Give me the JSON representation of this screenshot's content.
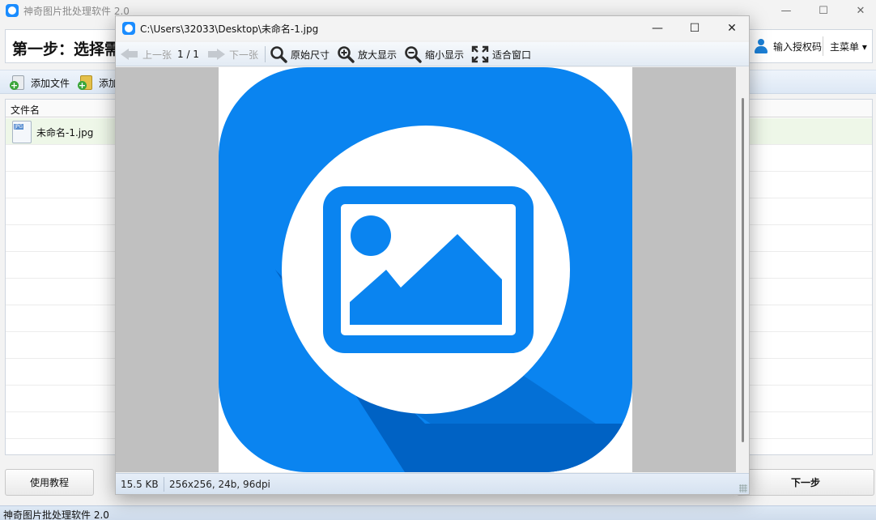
{
  "app": {
    "title": "神奇图片批处理软件 2.0",
    "step_title": "第一步：选择需",
    "auth_label": "输入授权码",
    "main_menu_label": "主菜单 ▾",
    "window_controls": {
      "minimize": "—",
      "maximize": "☐",
      "close": "✕"
    }
  },
  "toolbar": {
    "add_file_label": "添加文件",
    "add_folder_label": "添加"
  },
  "file_list": {
    "column_header": "文件名",
    "rows": [
      {
        "name": "未命名-1.jpg",
        "selected": true
      }
    ]
  },
  "bottom": {
    "tutorial_label": "使用教程",
    "next_label": "下一步"
  },
  "status_bar": {
    "text": "神奇图片批处理软件 2.0"
  },
  "viewer": {
    "title": "C:\\Users\\32033\\Desktop\\未命名-1.jpg",
    "window_controls": {
      "minimize": "—",
      "maximize": "☐",
      "close": "✕"
    },
    "toolbar": {
      "prev_label": "上一张",
      "page_indicator": "1 / 1",
      "next_label": "下一张",
      "original_size_label": "原始尺寸",
      "zoom_in_label": "放大显示",
      "zoom_out_label": "缩小显示",
      "fit_window_label": "适合窗口"
    },
    "status": {
      "file_size": "15.5 KB",
      "image_info": "256x256, 24b, 96dpi"
    },
    "image_colors": {
      "primary_blue": "#0a84f0",
      "shadow_blue": "#0062c4",
      "white": "#ffffff"
    }
  }
}
